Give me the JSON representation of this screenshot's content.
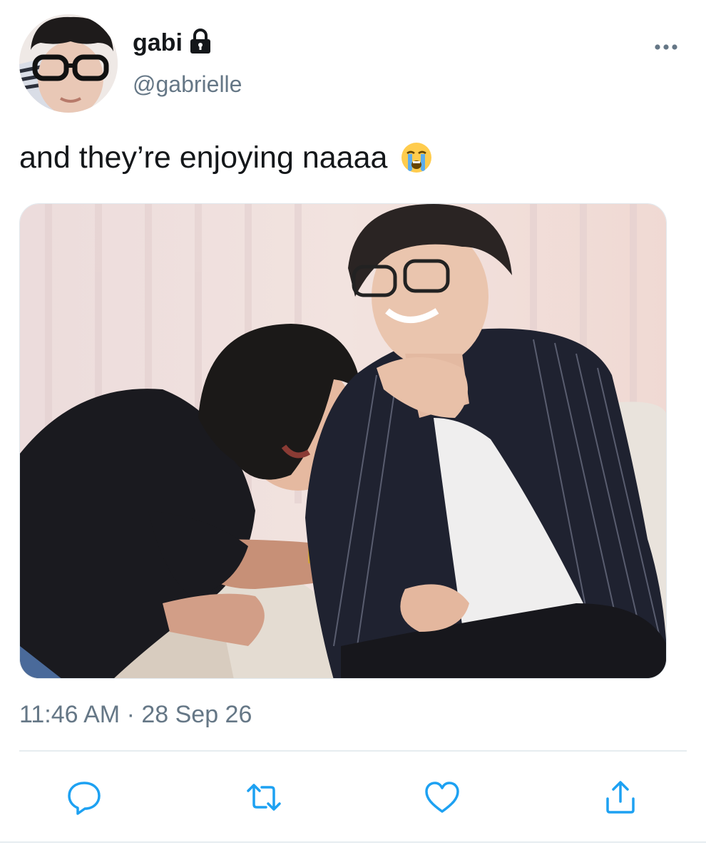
{
  "user": {
    "display_name": "gabi",
    "handle": "@gabrielle",
    "protected_icon": "lock-icon",
    "avatar": "profile-photo"
  },
  "header": {
    "more_icon": "more-horizontal-icon"
  },
  "tweet": {
    "text": "and they’re enjoying naaaa",
    "emoji": "loudly-crying-face-emoji",
    "timestamp": "11:46 AM · 28 Sep 26"
  },
  "media": {
    "kind": "photo"
  },
  "actions": {
    "reply_icon": "reply-icon",
    "retweet_icon": "retweet-icon",
    "like_icon": "heart-icon",
    "share_icon": "share-icon"
  },
  "colors": {
    "text": "#14171a",
    "secondary": "#657786",
    "icon": "#1da1f2",
    "divider": "#e6ecf0"
  }
}
